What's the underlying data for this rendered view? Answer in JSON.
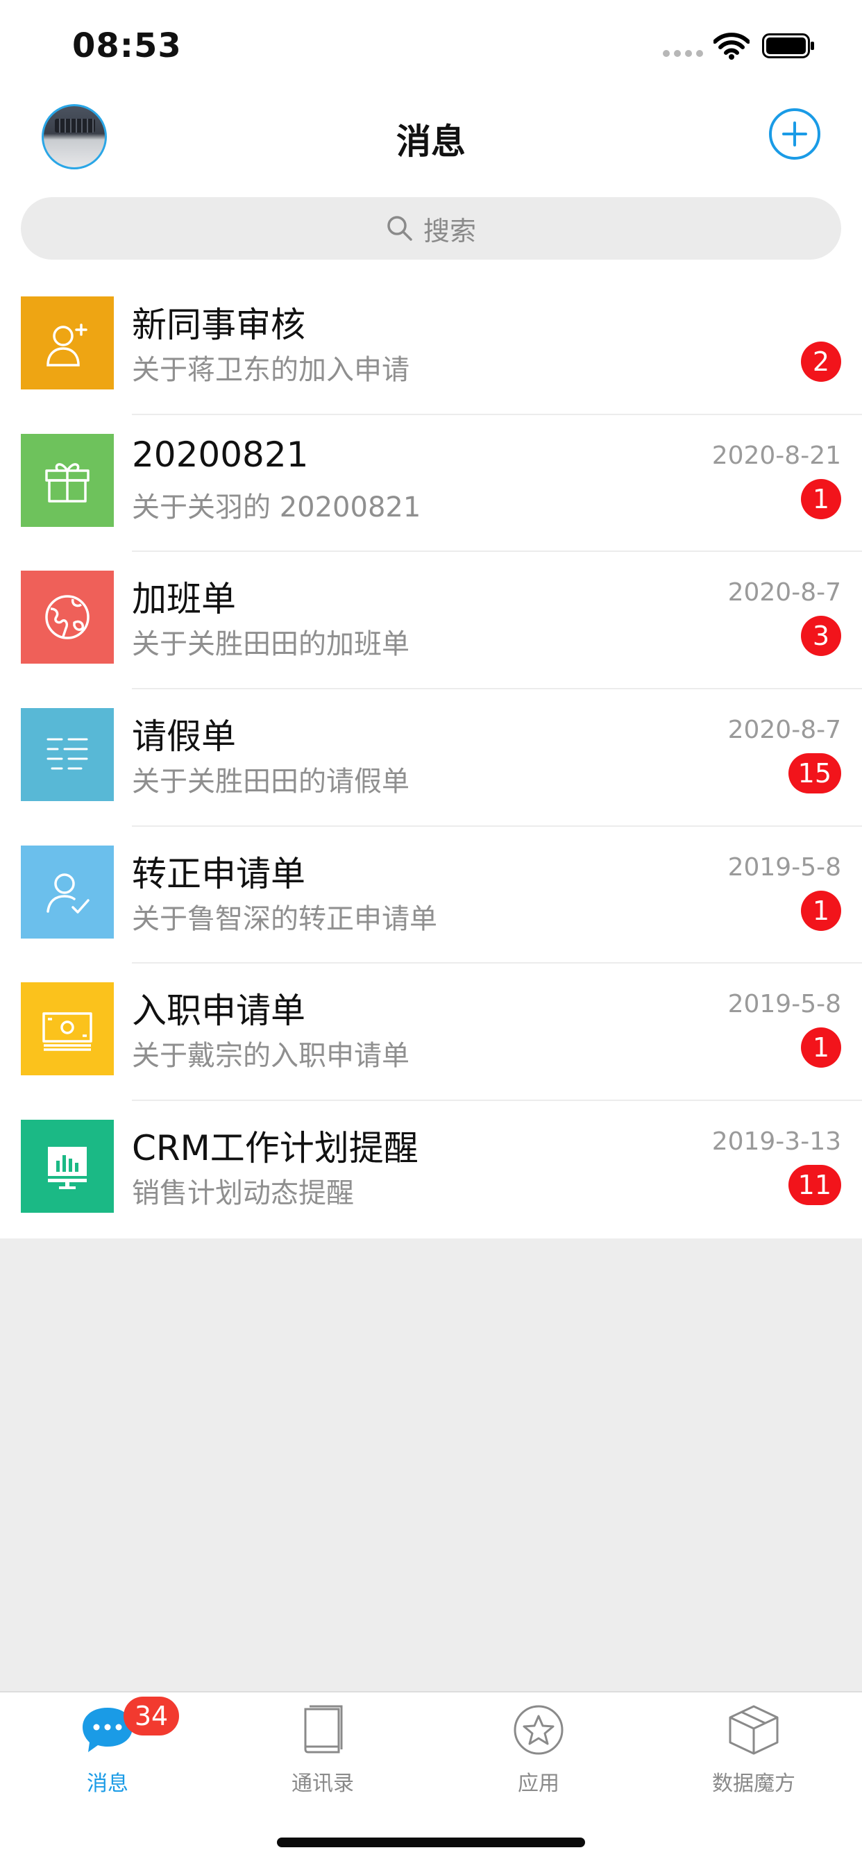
{
  "status_bar": {
    "time": "08:53"
  },
  "header": {
    "title": "消息"
  },
  "search": {
    "placeholder": "搜索"
  },
  "messages": [
    {
      "icon": "person-add-icon",
      "color": "#eea513",
      "title": "新同事审核",
      "subtitle": "关于蒋卫东的加入申请",
      "date": "",
      "badge": "2"
    },
    {
      "icon": "gift-icon",
      "color": "#6ec25c",
      "title": "20200821",
      "subtitle": "关于关羽的 20200821",
      "date": "2020-8-21",
      "badge": "1"
    },
    {
      "icon": "globe-icon",
      "color": "#ef6059",
      "title": "加班单",
      "subtitle": "关于关胜田田的加班单",
      "date": "2020-8-7",
      "badge": "3"
    },
    {
      "icon": "list-icon",
      "color": "#58b8d6",
      "title": "请假单",
      "subtitle": "关于关胜田田的请假单",
      "date": "2020-8-7",
      "badge": "15"
    },
    {
      "icon": "person-check-icon",
      "color": "#6bbfec",
      "title": "转正申请单",
      "subtitle": "关于鲁智深的转正申请单",
      "date": "2019-5-8",
      "badge": "1"
    },
    {
      "icon": "cash-icon",
      "color": "#fbc21c",
      "title": "入职申请单",
      "subtitle": "关于戴宗的入职申请单",
      "date": "2019-5-8",
      "badge": "1"
    },
    {
      "icon": "chart-board-icon",
      "color": "#1bb985",
      "title": "CRM工作计划提醒",
      "subtitle": "销售计划动态提醒",
      "date": "2019-3-13",
      "badge": "11"
    }
  ],
  "tabs": [
    {
      "label": "消息",
      "icon": "chat-bubble-icon",
      "active": true,
      "badge": "34"
    },
    {
      "label": "通讯录",
      "icon": "contacts-book-icon",
      "active": false
    },
    {
      "label": "应用",
      "icon": "star-icon",
      "active": false
    },
    {
      "label": "数据魔方",
      "icon": "cube-icon",
      "active": false
    }
  ],
  "colors": {
    "accent": "#1a9be6",
    "badge": "#f2141b"
  }
}
